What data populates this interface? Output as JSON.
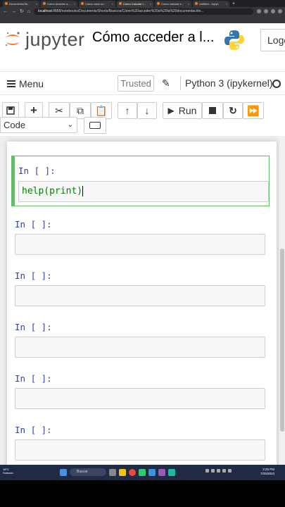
{
  "browser": {
    "tabs": [
      {
        "label": "Documents/Sh..."
      },
      {
        "label": "Cómo acceder a..."
      },
      {
        "label": "Cómo crear un..."
      },
      {
        "label": "Cómo Calcular l..."
      },
      {
        "label": "Cómo calcular e..."
      },
      {
        "label": "Untitled - Jupyt..."
      }
    ],
    "url_host": "localhost",
    "url_path": ":8888/notebooks/Documents/Shorts/Basicos/Cómo%20acceder%20a%20la%20documentación..."
  },
  "header": {
    "logo_text": "jupyter",
    "notebook_title": "Cómo acceder a l...",
    "logout_label": "Logo"
  },
  "menubar": {
    "menu_label": "Menu",
    "trusted_label": "Trusted",
    "kernel_label": "Python 3 (ipykernel)"
  },
  "toolbar": {
    "run_label": "Run",
    "cell_type": "Code"
  },
  "cells": [
    {
      "prompt": "In [ ]:",
      "source": "help(print)",
      "selected": true
    },
    {
      "prompt": "In [ ]:",
      "source": "",
      "selected": false
    },
    {
      "prompt": "In [ ]:",
      "source": "",
      "selected": false
    },
    {
      "prompt": "In [ ]:",
      "source": "",
      "selected": false
    },
    {
      "prompt": "In [ ]:",
      "source": "",
      "selected": false
    },
    {
      "prompt": "In [ ]:",
      "source": "",
      "selected": false
    }
  ],
  "taskbar": {
    "weather_temp": "18°C",
    "weather_desc": "Soleado",
    "search_label": "Buscar",
    "time": "2:25 PM",
    "date": "7/25/2023"
  },
  "colors": {
    "prompt": "#303f9f",
    "selected_cell_border": "#66bb6a",
    "code_builtin": "#008000",
    "jupyter_orange": "#f37726"
  }
}
